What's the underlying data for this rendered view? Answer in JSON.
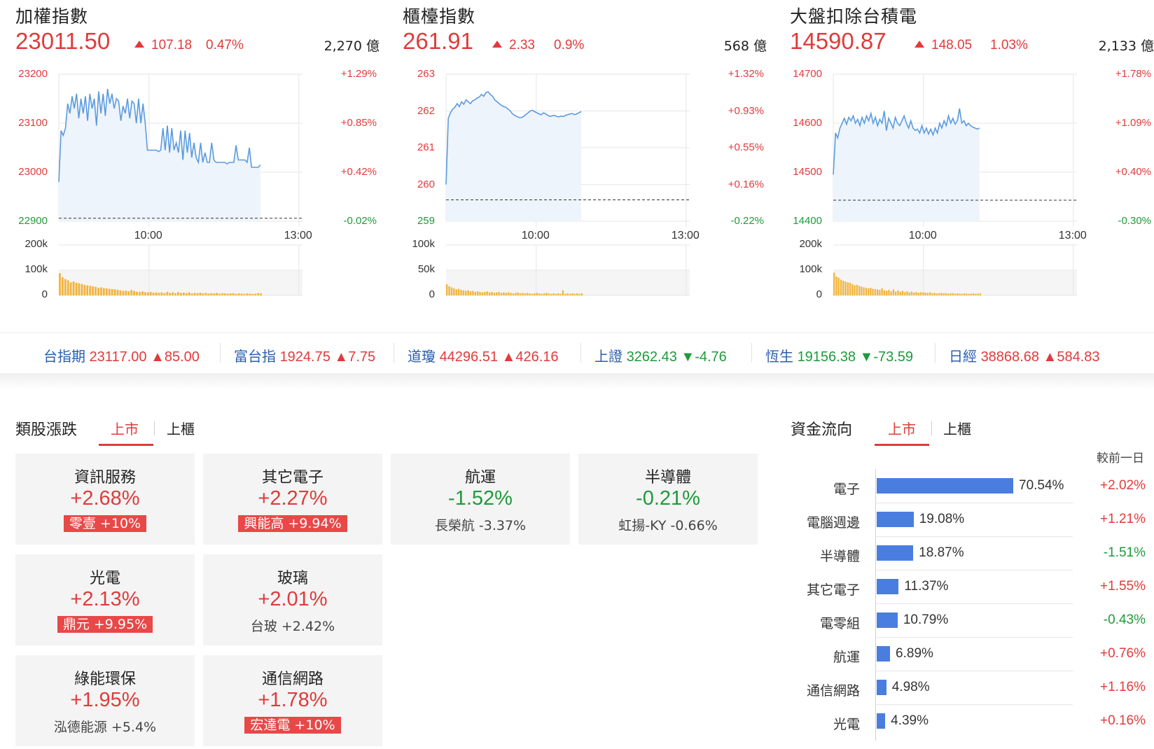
{
  "panels": [
    {
      "title": "加權指數",
      "price": "23011.50",
      "change": "107.18",
      "pct": "0.47%",
      "volume": "2,270 億",
      "y_left": [
        "23200",
        "23100",
        "23000",
        "22900"
      ],
      "y_right": [
        "+1.29%",
        "+0.85%",
        "+0.42%",
        "-0.02%"
      ],
      "y_colors": [
        "red",
        "red",
        "red",
        "green"
      ],
      "x_ticks": [
        "10:00",
        "13:00"
      ],
      "vol_ticks": [
        "200k",
        "100k",
        "0"
      ],
      "ylim": [
        22900,
        23200
      ],
      "ref": 22906,
      "vol_max": 200,
      "series": [
        22980,
        23085,
        23075,
        23090,
        23140,
        23120,
        23155,
        23130,
        23160,
        23110,
        23150,
        23120,
        23155,
        23105,
        23160,
        23130,
        23150,
        23095,
        23165,
        23120,
        23160,
        23115,
        23170,
        23140,
        23160,
        23130,
        23150,
        23145,
        23105,
        23135,
        23120,
        23150,
        23110,
        23145,
        23140,
        23100,
        23150,
        23100,
        23140,
        23100,
        23045,
        23045,
        23045,
        23045,
        23045,
        23042,
        23045,
        23090,
        23045,
        23095,
        23040,
        23090,
        23045,
        23060,
        23040,
        23085,
        23025,
        23085,
        23040,
        23080,
        23030,
        23060,
        23030,
        23020,
        23060,
        23020,
        23040,
        23020,
        23020,
        23060,
        23025,
        23020,
        23020,
        23020,
        23020,
        23020,
        23017,
        23020,
        23020,
        23020,
        23055,
        23025,
        23025,
        23025,
        23025,
        23020,
        23050,
        23010,
        23010,
        23010,
        23010,
        23015
      ],
      "volumes": [
        88,
        72,
        65,
        60,
        52,
        55,
        50,
        48,
        45,
        42,
        40,
        38,
        36,
        34,
        30,
        32,
        29,
        28,
        26,
        25,
        24,
        22,
        20,
        18,
        19,
        16,
        22,
        18,
        15,
        14,
        16,
        13,
        12,
        14,
        11,
        12,
        10,
        12,
        9,
        14,
        10,
        12,
        9,
        13,
        10,
        11,
        9,
        12,
        8,
        10,
        9,
        11,
        8,
        10,
        7,
        9,
        8,
        10,
        7,
        9,
        8,
        7,
        8,
        9,
        6,
        8,
        7,
        6,
        8,
        7,
        6,
        7,
        9,
        8
      ]
    },
    {
      "title": "櫃檯指數",
      "price": "261.91",
      "change": "2.33",
      "pct": "0.9%",
      "volume": "568 億",
      "y_left": [
        "263",
        "262",
        "261",
        "260",
        "259"
      ],
      "y_right": [
        "+1.32%",
        "+0.93%",
        "+0.55%",
        "+0.16%",
        "-0.22%"
      ],
      "y_colors": [
        "red",
        "red",
        "red",
        "red",
        "green"
      ],
      "x_ticks": [
        "10:00",
        "13:00"
      ],
      "vol_ticks": [
        "100k",
        "50k",
        "0"
      ],
      "ylim": [
        259,
        263
      ],
      "ref": 259.58,
      "vol_max": 100,
      "series": [
        260.0,
        261.8,
        261.95,
        262.05,
        262.1,
        262.2,
        262.12,
        262.25,
        262.18,
        262.3,
        262.25,
        262.2,
        262.28,
        262.3,
        262.35,
        262.38,
        262.45,
        262.4,
        262.5,
        262.52,
        262.45,
        262.4,
        262.3,
        262.25,
        262.2,
        262.15,
        262.12,
        262.1,
        262.05,
        262.0,
        261.92,
        261.88,
        261.85,
        261.82,
        261.82,
        261.85,
        261.9,
        261.95,
        262.0,
        262.02,
        261.98,
        261.95,
        261.92,
        261.9,
        261.95,
        261.92,
        261.88,
        261.85,
        261.87,
        261.88,
        261.85,
        261.84,
        261.86,
        261.85,
        261.88,
        261.9,
        261.92,
        261.93,
        261.9,
        261.92,
        261.95,
        261.98
      ],
      "volumes": [
        22,
        18,
        16,
        14,
        12,
        13,
        11,
        10,
        9,
        10,
        8,
        9,
        7,
        8,
        7,
        6,
        7,
        8,
        6,
        7,
        5,
        6,
        7,
        5,
        6,
        5,
        6,
        5,
        4,
        5,
        6,
        4,
        5,
        4,
        5,
        4,
        3,
        4,
        5,
        4,
        3,
        4,
        5,
        4,
        3,
        4,
        3,
        4,
        3,
        10,
        3,
        4,
        3,
        4,
        3,
        4,
        3,
        4
      ]
    },
    {
      "title": "大盤扣除台積電",
      "price": "14590.87",
      "change": "148.05",
      "pct": "1.03%",
      "volume": "2,133 億",
      "y_left": [
        "14700",
        "14600",
        "14500",
        "14400"
      ],
      "y_right": [
        "+1.78%",
        "+1.09%",
        "+0.40%",
        "-0.30%"
      ],
      "y_colors": [
        "red",
        "red",
        "red",
        "green"
      ],
      "x_ticks": [
        "10:00",
        "13:00"
      ],
      "vol_ticks": [
        "200k",
        "100k",
        "0"
      ],
      "ylim": [
        14400,
        14700
      ],
      "ref": 14442.82,
      "vol_max": 200,
      "series": [
        14495,
        14580,
        14570,
        14590,
        14600,
        14610,
        14598,
        14612,
        14605,
        14615,
        14600,
        14608,
        14595,
        14612,
        14600,
        14615,
        14605,
        14620,
        14600,
        14612,
        14595,
        14608,
        14600,
        14625,
        14585,
        14610,
        14600,
        14590,
        14612,
        14600,
        14595,
        14605,
        14615,
        14600,
        14590,
        14605,
        14590,
        14585,
        14588,
        14580,
        14595,
        14580,
        14590,
        14578,
        14588,
        14576,
        14590,
        14580,
        14600,
        14590,
        14605,
        14595,
        14615,
        14600,
        14610,
        14598,
        14605,
        14630,
        14600,
        14605,
        14595,
        14600,
        14595,
        14592,
        14590,
        14588,
        14590
      ],
      "volumes": [
        90,
        75,
        70,
        62,
        58,
        55,
        52,
        50,
        45,
        40,
        42,
        38,
        35,
        32,
        30,
        28,
        30,
        26,
        25,
        24,
        22,
        28,
        20,
        18,
        22,
        16,
        24,
        15,
        20,
        14,
        18,
        13,
        16,
        12,
        15,
        11,
        14,
        10,
        13,
        12,
        11,
        10,
        12,
        9,
        10,
        8,
        9,
        10,
        8,
        9,
        7,
        8,
        9,
        7,
        8,
        7,
        6,
        8,
        7,
        6,
        7,
        8,
        6,
        7,
        8
      ]
    }
  ],
  "tickers": [
    {
      "name": "台指期",
      "value": "23117.00",
      "change": "▲85.00",
      "dir": "up"
    },
    {
      "name": "富台指",
      "value": "1924.75",
      "change": "▲7.75",
      "dir": "up"
    },
    {
      "name": "道瓊",
      "value": "44296.51",
      "change": "▲426.16",
      "dir": "up"
    },
    {
      "name": "上證",
      "value": "3262.43",
      "change": "▼-4.76",
      "dir": "dn"
    },
    {
      "name": "恆生",
      "value": "19156.38",
      "change": "▼-73.59",
      "dir": "dn"
    },
    {
      "name": "日經",
      "value": "38868.68",
      "change": "▲584.83",
      "dir": "up"
    }
  ],
  "sector": {
    "title": "類股漲跌",
    "tabs": [
      "上市",
      "上櫃"
    ],
    "cards": [
      {
        "name": "資訊服務",
        "pct": "+2.68%",
        "dir": "up",
        "stock": "零壹  +10%",
        "badge": true
      },
      {
        "name": "其它電子",
        "pct": "+2.27%",
        "dir": "up",
        "stock": "興能高  +9.94%",
        "badge": true
      },
      {
        "name": "航運",
        "pct": "-1.52%",
        "dir": "dn",
        "stock": "長榮航  -3.37%",
        "badge": false
      },
      {
        "name": "半導體",
        "pct": "-0.21%",
        "dir": "dn",
        "stock": "虹揚-KY  -0.66%",
        "badge": false
      },
      {
        "name": "光電",
        "pct": "+2.13%",
        "dir": "up",
        "stock": "鼎元  +9.95%",
        "badge": true
      },
      {
        "name": "玻璃",
        "pct": "+2.01%",
        "dir": "up",
        "stock": "台玻  +2.42%",
        "badge": false
      },
      {
        "name": "綠能環保",
        "pct": "+1.95%",
        "dir": "up",
        "stock": "泓德能源  +5.4%",
        "badge": false
      },
      {
        "name": "通信網路",
        "pct": "+1.78%",
        "dir": "up",
        "stock": "宏達電  +10%",
        "badge": true
      }
    ]
  },
  "flow": {
    "title": "資金流向",
    "tabs": [
      "上市",
      "上櫃"
    ],
    "compare_label": "較前一日",
    "items": [
      {
        "name": "電子",
        "share": 70.54,
        "share_label": "70.54%",
        "chg": "+2.02%",
        "dir": "up"
      },
      {
        "name": "電腦週邊",
        "share": 19.08,
        "share_label": "19.08%",
        "chg": "+1.21%",
        "dir": "up"
      },
      {
        "name": "半導體",
        "share": 18.87,
        "share_label": "18.87%",
        "chg": "-1.51%",
        "dir": "dn"
      },
      {
        "name": "其它電子",
        "share": 11.37,
        "share_label": "11.37%",
        "chg": "+1.55%",
        "dir": "up"
      },
      {
        "name": "電零組",
        "share": 10.79,
        "share_label": "10.79%",
        "chg": "-0.43%",
        "dir": "dn"
      },
      {
        "name": "航運",
        "share": 6.89,
        "share_label": "6.89%",
        "chg": "+0.76%",
        "dir": "up"
      },
      {
        "name": "通信網路",
        "share": 4.98,
        "share_label": "4.98%",
        "chg": "+1.16%",
        "dir": "up"
      },
      {
        "name": "光電",
        "share": 4.39,
        "share_label": "4.39%",
        "chg": "+0.16%",
        "dir": "up"
      }
    ]
  },
  "colors": {
    "up": "#e03b3b",
    "down": "#1e9b3a",
    "line": "#5b9be0",
    "fill": "#eef4fb",
    "bar": "#f3b43a",
    "flow_bar": "#4a7de0"
  }
}
